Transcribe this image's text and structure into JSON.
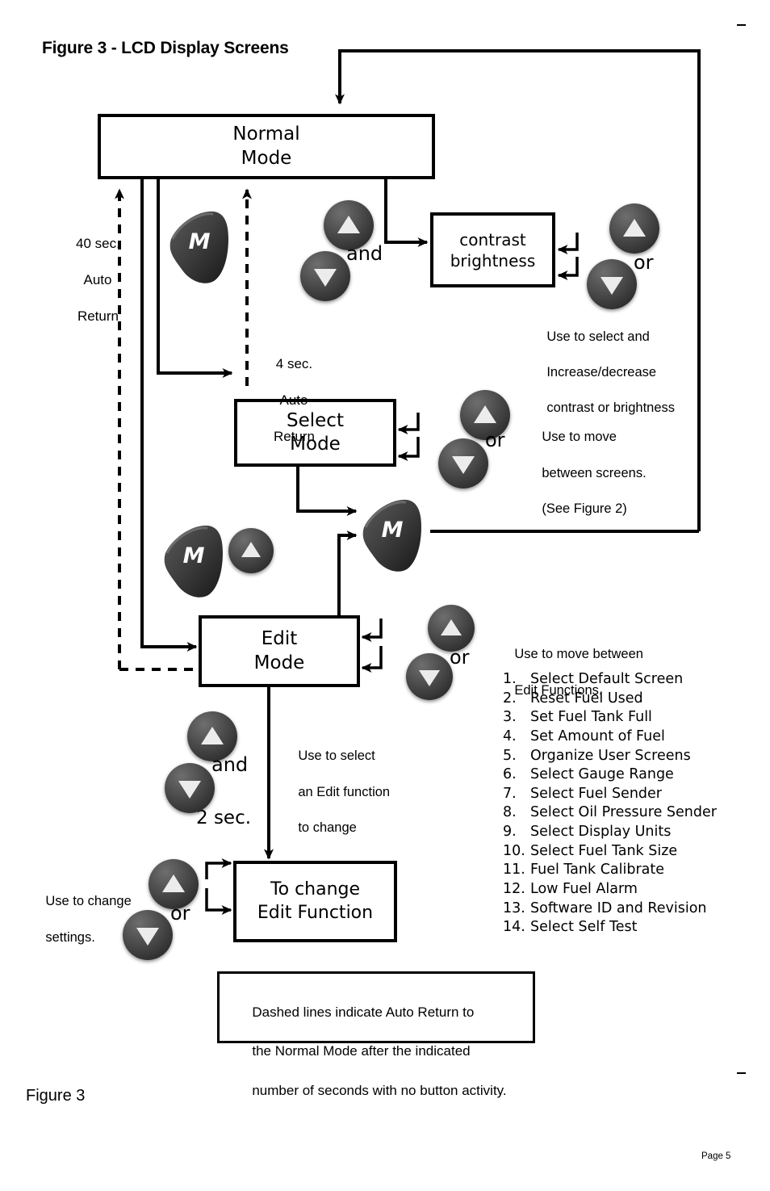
{
  "document": {
    "title": "Figure 3 - LCD Display Screens",
    "figure_caption": "Figure 3",
    "page_label": "Page 5"
  },
  "nodes": {
    "normal_mode": {
      "line1": "Normal",
      "line2": "Mode"
    },
    "contrast": {
      "line1": "contrast",
      "line2": "brightness"
    },
    "select_mode": {
      "line1": "Select",
      "line2": "Mode"
    },
    "edit_mode": {
      "line1": "Edit",
      "line2": "Mode"
    },
    "to_change": {
      "line1": "To change",
      "line2": "Edit Function"
    }
  },
  "timers": {
    "normal_return": {
      "line1": "40 sec.",
      "line2": "Auto",
      "line3": "Return"
    },
    "select_return": {
      "line1": "4 sec.",
      "line2": "Auto",
      "line3": "Return"
    },
    "hold_two_sec": "2 sec."
  },
  "connectors": {
    "and_contrast": "and",
    "or_contrast": "or",
    "or_select": "or",
    "or_edit": "or",
    "and_edit": "and",
    "or_settings": "or"
  },
  "annotations": {
    "contrast_help": {
      "line1": "Use to select and",
      "line2": "Increase/decrease",
      "line3": "contrast or brightness"
    },
    "select_help": {
      "line1": "Use to move",
      "line2": "between screens.",
      "line3": "(See Figure 2)"
    },
    "edit_help": {
      "line1": "Use to move between",
      "line2": "Edit Functions."
    },
    "edit_select_help": {
      "line1": "Use to select",
      "line2": "an Edit function",
      "line3": "to change"
    },
    "settings_help": {
      "line1": "Use to change",
      "line2": "settings."
    },
    "dashed_note": {
      "line1": "Dashed lines indicate Auto Return to",
      "line2": "the Normal Mode after the indicated",
      "line3": "number of seconds with no button activity."
    }
  },
  "edit_functions": [
    {
      "num": "1.",
      "label": "Select Default Screen"
    },
    {
      "num": "2.",
      "label": "Reset Fuel Used"
    },
    {
      "num": "3.",
      "label": "Set Fuel Tank Full"
    },
    {
      "num": "4.",
      "label": "Set Amount of Fuel"
    },
    {
      "num": "5.",
      "label": "Organize User Screens"
    },
    {
      "num": "6.",
      "label": "Select Gauge Range"
    },
    {
      "num": "7.",
      "label": "Select Fuel Sender"
    },
    {
      "num": "8.",
      "label": "Select Oil Pressure Sender"
    },
    {
      "num": "9.",
      "label": "Select Display Units"
    },
    {
      "num": "10.",
      "label": "Select Fuel Tank Size"
    },
    {
      "num": "11.",
      "label": "Fuel Tank Calibrate"
    },
    {
      "num": "12.",
      "label": "Low Fuel Alarm"
    },
    {
      "num": "13.",
      "label": "Software ID and Revision"
    },
    {
      "num": "14.",
      "label": "Select Self Test"
    }
  ],
  "buttons": {
    "mode_button_glyph": "M",
    "up_button": "up-arrow-button",
    "down_button": "down-arrow-button"
  },
  "colors": {
    "line": "#000000",
    "button_dark": "#3c3c3c",
    "button_highlight": "#6e6e6e",
    "triangle": "#e8e8e8",
    "background": "#ffffff"
  }
}
